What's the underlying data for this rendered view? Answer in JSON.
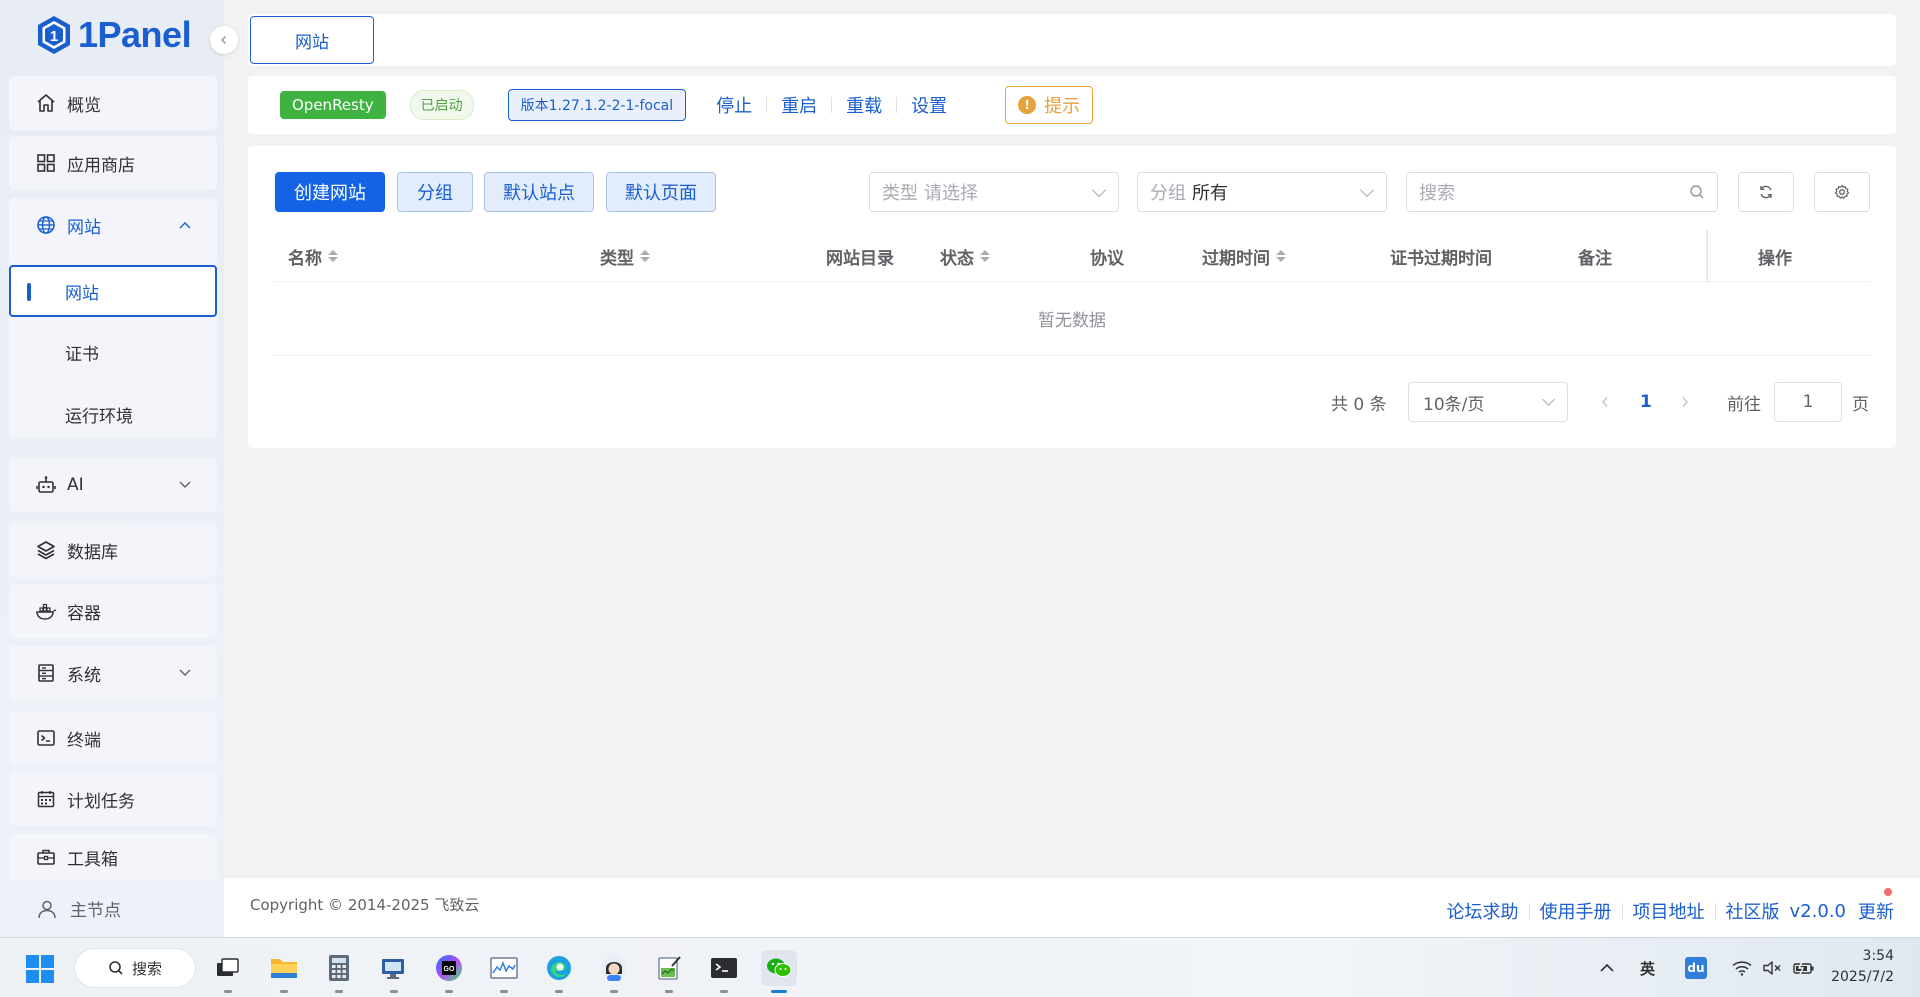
{
  "app": {
    "name": "1Panel",
    "collapse_icon": "chevron-left-icon"
  },
  "sidebar": {
    "items": [
      {
        "label": "概览",
        "icon": "home-icon"
      },
      {
        "label": "应用商店",
        "icon": "grid-icon"
      },
      {
        "label": "网站",
        "icon": "globe-icon",
        "expanded": true
      },
      {
        "label": "AI",
        "icon": "robot-icon"
      },
      {
        "label": "数据库",
        "icon": "layers-icon"
      },
      {
        "label": "容器",
        "icon": "docker-icon"
      },
      {
        "label": "系统",
        "icon": "server-icon"
      },
      {
        "label": "终端",
        "icon": "terminal-icon"
      },
      {
        "label": "计划任务",
        "icon": "calendar-icon"
      },
      {
        "label": "工具箱",
        "icon": "toolbox-icon"
      }
    ],
    "website_sub": [
      "网站",
      "证书",
      "运行环境"
    ],
    "bottom_node": "主节点"
  },
  "tabs": [
    {
      "label": "网站"
    }
  ],
  "status": {
    "app_name": "OpenResty",
    "state": "已启动",
    "version": "版本1.27.1.2-2-1-focal",
    "actions": [
      "停止",
      "重启",
      "重载",
      "设置"
    ],
    "hint": "提示"
  },
  "toolbar": {
    "create": "创建网站",
    "group": "分组",
    "default_site": "默认站点",
    "default_page": "默认页面",
    "type_label": "类型",
    "type_placeholder": "请选择",
    "group_label": "分组",
    "group_value": "所有",
    "search_placeholder": "搜索"
  },
  "table": {
    "columns": [
      "名称",
      "类型",
      "网站目录",
      "状态",
      "协议",
      "过期时间",
      "证书过期时间",
      "备注",
      "操作"
    ],
    "empty_text": "暂无数据"
  },
  "pagination": {
    "total": "共 0 条",
    "page_size": "10条/页",
    "current_page": "1",
    "goto_label": "前往",
    "goto_value": "1",
    "page_suffix": "页"
  },
  "footer": {
    "copyright": "Copyright © 2014-2025 飞致云",
    "links": [
      "论坛求助",
      "使用手册",
      "项目地址",
      "社区版",
      "v2.0.0",
      "更新"
    ]
  },
  "taskbar": {
    "search_label": "搜索",
    "tray_ime": "英",
    "tray_du": "du",
    "time": "3:54",
    "date": "2025/7/2"
  },
  "colors": {
    "brand": "#1a5fd0",
    "primary_button": "#1463e6",
    "success": "#3fb342",
    "warning": "#e6a23c"
  }
}
